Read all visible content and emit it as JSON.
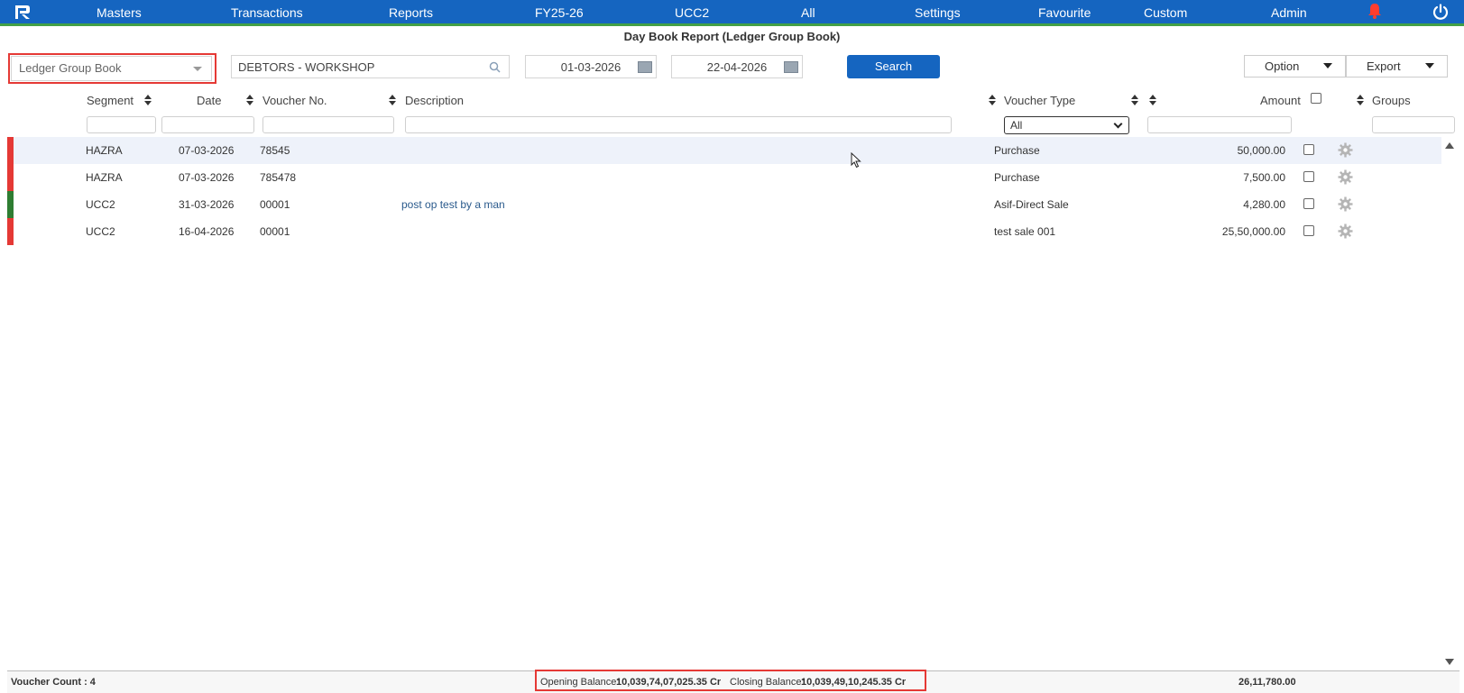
{
  "nav": {
    "items": [
      "Masters",
      "Transactions",
      "Reports",
      "FY25-26",
      "UCC2",
      "All",
      "Settings",
      "Favourite",
      "Custom",
      "Admin"
    ]
  },
  "report": {
    "title": "Day Book Report (Ledger Group Book)"
  },
  "toolbar": {
    "book_type": "Ledger Group Book",
    "ledger_group": "DEBTORS - WORKSHOP",
    "from_date": "01-03-2026",
    "to_date": "22-04-2026",
    "search_label": "Search",
    "option_label": "Option",
    "export_label": "Export"
  },
  "table": {
    "headers": {
      "segment": "Segment",
      "date": "Date",
      "voucher_no": "Voucher No.",
      "description": "Description",
      "voucher_type": "Voucher Type",
      "amount": "Amount",
      "groups": "Groups"
    },
    "voucher_type_filter": "All",
    "rows": [
      {
        "segment": "HAZRA",
        "date": "07-03-2026",
        "voucher_no": "78545",
        "description": "",
        "voucher_type": "Purchase",
        "amount": "50,000.00",
        "status_color": "#e53935"
      },
      {
        "segment": "HAZRA",
        "date": "07-03-2026",
        "voucher_no": "785478",
        "description": "",
        "voucher_type": "Purchase",
        "amount": "7,500.00",
        "status_color": "#e53935"
      },
      {
        "segment": "UCC2",
        "date": "31-03-2026",
        "voucher_no": "00001",
        "description": "post op test by a man",
        "voucher_type": "Asif-Direct Sale",
        "amount": "4,280.00",
        "status_color": "#2e7d32"
      },
      {
        "segment": "UCC2",
        "date": "16-04-2026",
        "voucher_no": "00001",
        "description": "",
        "voucher_type": "test sale 001",
        "amount": "25,50,000.00",
        "status_color": "#e53935"
      }
    ]
  },
  "footer": {
    "voucher_count": "Voucher Count : 4",
    "opening_label": "Opening Balance:",
    "opening_value": "10,039,74,07,025.35 Cr",
    "closing_label": "Closing Balance:",
    "closing_value": "10,039,49,10,245.35 Cr",
    "total_amount": "26,11,780.00"
  },
  "colors": {
    "nav_bg": "#1565c0",
    "nav_accent": "#43a047",
    "highlight_outline": "#e53935"
  },
  "icons": [
    "app-logo-icon",
    "bell-icon",
    "power-icon",
    "search-icon",
    "calendar-icon",
    "gear-icon"
  ]
}
